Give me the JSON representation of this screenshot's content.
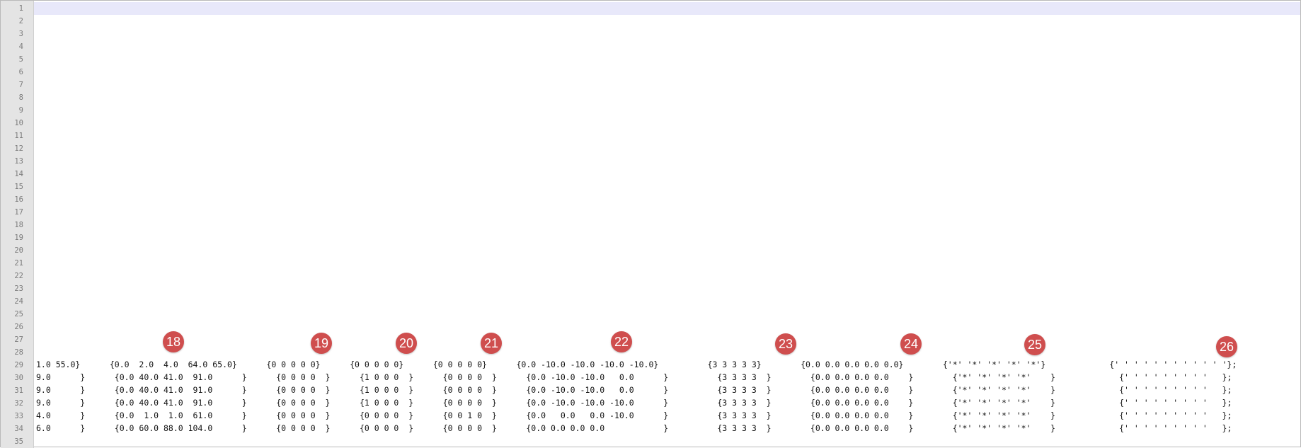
{
  "editor": {
    "line_numbers": [
      "1",
      "2",
      "3",
      "4",
      "5",
      "6",
      "7",
      "8",
      "9",
      "10",
      "11",
      "12",
      "13",
      "14",
      "15",
      "16",
      "17",
      "18",
      "19",
      "20",
      "21",
      "22",
      "23",
      "24",
      "25",
      "26",
      "27",
      "28",
      "29",
      "30",
      "31",
      "32",
      "33",
      "34",
      "35"
    ],
    "markers": [
      "18",
      "19",
      "20",
      "21",
      "22",
      "23",
      "24",
      "25",
      "26"
    ],
    "lines": [
      {
        "line": "29",
        "text": "1.0 55.0}      {0.0  2.0  4.0  64.0 65.0}      {0 0 0 0 0}      {0 0 0 0 0}      {0 0 0 0 0}      {0.0 -10.0 -10.0 -10.0 -10.0}          {3 3 3 3 3}        {0.0 0.0 0.0 0.0 0.0}        {'*' '*' '*' '*' '*'}             {' ' ' ' ' ' ' ' ' ' ' '};"
      },
      {
        "line": "30",
        "text": "9.0      }      {0.0 40.0 41.0  91.0      }      {0 0 0 0  }      {1 0 0 0  }      {0 0 0 0  }      {0.0 -10.0 -10.0   0.0      }          {3 3 3 3  }        {0.0 0.0 0.0 0.0    }        {'*' '*' '*' '*'    }             {' ' ' ' ' ' ' ' '   };"
      },
      {
        "line": "31",
        "text": "9.0      }      {0.0 40.0 41.0  91.0      }      {0 0 0 0  }      {1 0 0 0  }      {0 0 0 0  }      {0.0 -10.0 -10.0   0.0      }          {3 3 3 3  }        {0.0 0.0 0.0 0.0    }        {'*' '*' '*' '*'    }             {' ' ' ' ' ' ' ' '   };"
      },
      {
        "line": "32",
        "text": "9.0      }      {0.0 40.0 41.0  91.0      }      {0 0 0 0  }      {1 0 0 0  }      {0 0 0 0  }      {0.0 -10.0 -10.0 -10.0      }          {3 3 3 3  }        {0.0 0.0 0.0 0.0    }        {'*' '*' '*' '*'    }             {' ' ' ' ' ' ' ' '   };"
      },
      {
        "line": "33",
        "text": "4.0      }      {0.0  1.0  1.0  61.0      }      {0 0 0 0  }      {0 0 0 0  }      {0 0 1 0  }      {0.0   0.0   0.0 -10.0      }          {3 3 3 3  }        {0.0 0.0 0.0 0.0    }        {'*' '*' '*' '*'    }             {' ' ' ' ' ' ' ' '   };"
      },
      {
        "line": "34",
        "text": "6.0      }      {0.0 60.0 88.0 104.0      }      {0 0 0 0  }      {0 0 0 0  }      {0 0 0 0  }      {0.0 0.0 0.0 0.0            }          {3 3 3 3  }        {0.0 0.0 0.0 0.0    }        {'*' '*' '*' '*'    }             {' ' ' ' ' ' ' ' '   };"
      }
    ]
  }
}
